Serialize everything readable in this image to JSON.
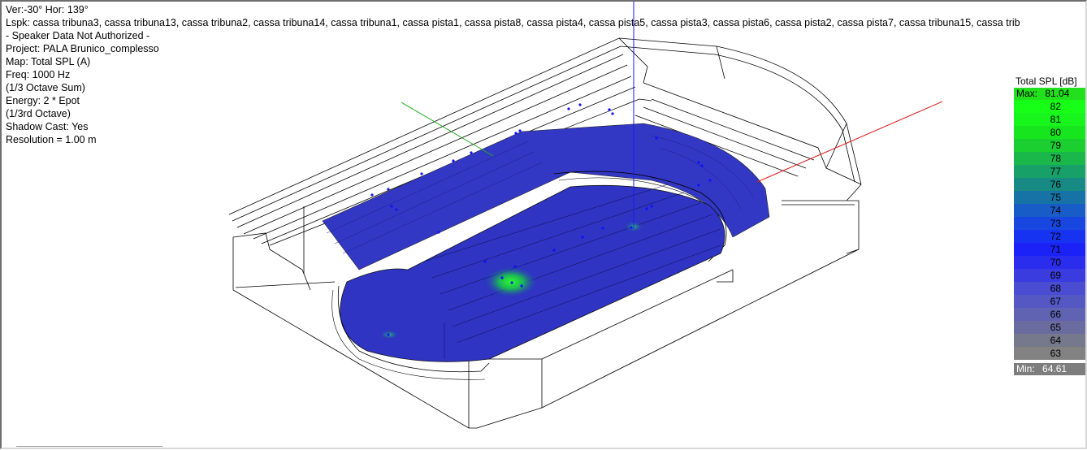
{
  "info": {
    "view": "Ver:-30°  Hor: 139°",
    "lspk": "Lspk: cassa tribuna3, cassa tribuna13, cassa tribuna2, cassa tribuna14, cassa tribuna1, cassa pista1, cassa pista8, cassa pista4, cassa pista5, cassa pista3, cassa pista6, cassa pista2, cassa pista7, cassa tribuna15, cassa trib",
    "auth": "- Speaker Data Not Authorized -",
    "project": "Project: PALA Brunico_complesso",
    "map": "Map: Total SPL (A)",
    "freq": "Freq: 1000 Hz",
    "octave_sum": "(1/3 Octave Sum)",
    "energy": "Energy: 2 * Epot",
    "octave_band": "(1/3rd Octave)",
    "shadow": "Shadow Cast: Yes",
    "resolution": "Resolution =   1.00 m"
  },
  "legend": {
    "title": "Total SPL [dB]",
    "max_label": "Max:",
    "max_value": "81.04",
    "min_label": "Min:",
    "min_value": "64.61",
    "rows": [
      {
        "value": "82",
        "color": "#17ff17"
      },
      {
        "value": "81",
        "color": "#17f51c"
      },
      {
        "value": "80",
        "color": "#17e61f"
      },
      {
        "value": "79",
        "color": "#1ccf30"
      },
      {
        "value": "78",
        "color": "#1ab84a"
      },
      {
        "value": "77",
        "color": "#17a068"
      },
      {
        "value": "76",
        "color": "#178a84"
      },
      {
        "value": "75",
        "color": "#1773a6"
      },
      {
        "value": "74",
        "color": "#175cc7"
      },
      {
        "value": "73",
        "color": "#1747e0"
      },
      {
        "value": "72",
        "color": "#1733f2"
      },
      {
        "value": "71",
        "color": "#1a22f7"
      },
      {
        "value": "70",
        "color": "#2a2cee"
      },
      {
        "value": "69",
        "color": "#3a3ce0"
      },
      {
        "value": "68",
        "color": "#4a4cd2"
      },
      {
        "value": "67",
        "color": "#5557c3"
      },
      {
        "value": "66",
        "color": "#6062b2"
      },
      {
        "value": "65",
        "color": "#6a6ca0"
      },
      {
        "value": "64",
        "color": "#76788c"
      },
      {
        "value": "63",
        "color": "#828282"
      }
    ]
  }
}
